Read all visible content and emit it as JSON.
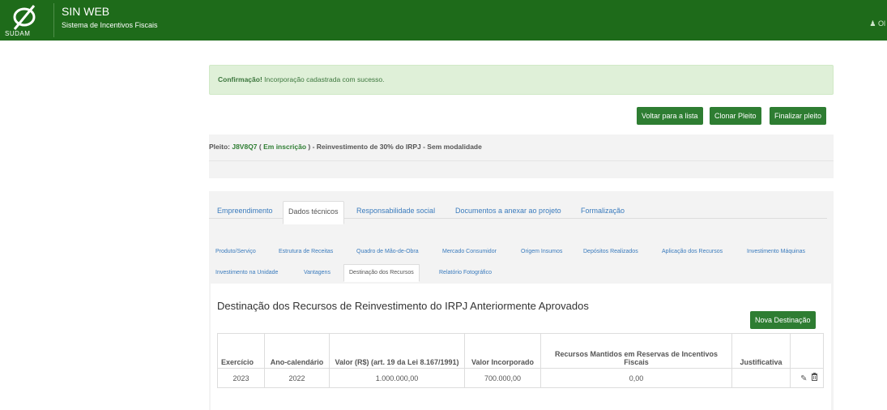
{
  "header": {
    "logo_text": "SUDAM",
    "app_title": "SIN WEB",
    "app_subtitle": "Sistema de Incentivos Fiscais",
    "user_label": "Ol"
  },
  "alert": {
    "strong": "Confirmação!",
    "message": " Incorporação cadastrada com sucesso."
  },
  "actions": {
    "back": "Voltar para a lista",
    "clone": "Clonar Pleito",
    "finish": "Finalizar pleito"
  },
  "pleito": {
    "prefix": "Pleito: ",
    "code": "J8V8Q7",
    "status_open": " ( ",
    "status": "Em inscrição",
    "status_close": " )",
    "description": " - Reinvestimento de 30% do IRPJ - Sem modalidade"
  },
  "main_tabs": [
    "Empreendimento",
    "Dados técnicos",
    "Responsabilidade social",
    "Documentos a anexar ao projeto",
    "Formalização"
  ],
  "sub_tabs": [
    "Produto/Serviço",
    "Estrutura de Receitas",
    "Quadro de Mão-de-Obra",
    "Mercado Consumidor",
    "Origem Insumos",
    "Depósitos Realizados",
    "Aplicação dos Recursos",
    "Investimento Máquinas",
    "Investimento na Unidade",
    "Vantagens",
    "Destinação dos Recursos",
    "Relatório Fotográfico"
  ],
  "section": {
    "title": "Destinação dos Recursos de Reinvestimento do IRPJ Anteriormente Aprovados",
    "new_button": "Nova Destinação"
  },
  "table": {
    "headers": [
      "Exercício",
      "Ano-calendário",
      "Valor (R$) (art. 19 da Lei 8.167/1991)",
      "Valor Incorporado",
      "Recursos Mantidos em Reservas de Incentivos Fiscais",
      "Justificativa"
    ],
    "rows": [
      [
        "2023",
        "2022",
        "1.000.000,00",
        "700.000,00",
        "0,00",
        ""
      ]
    ]
  },
  "icons": {
    "edit": "pencil-icon",
    "delete": "trash-icon",
    "user": "user-icon"
  },
  "colors": {
    "header_bg": "#1e6b1a",
    "button_bg": "#2e7d32",
    "alert_bg": "#dff0d8",
    "link": "#3a7bbd"
  }
}
